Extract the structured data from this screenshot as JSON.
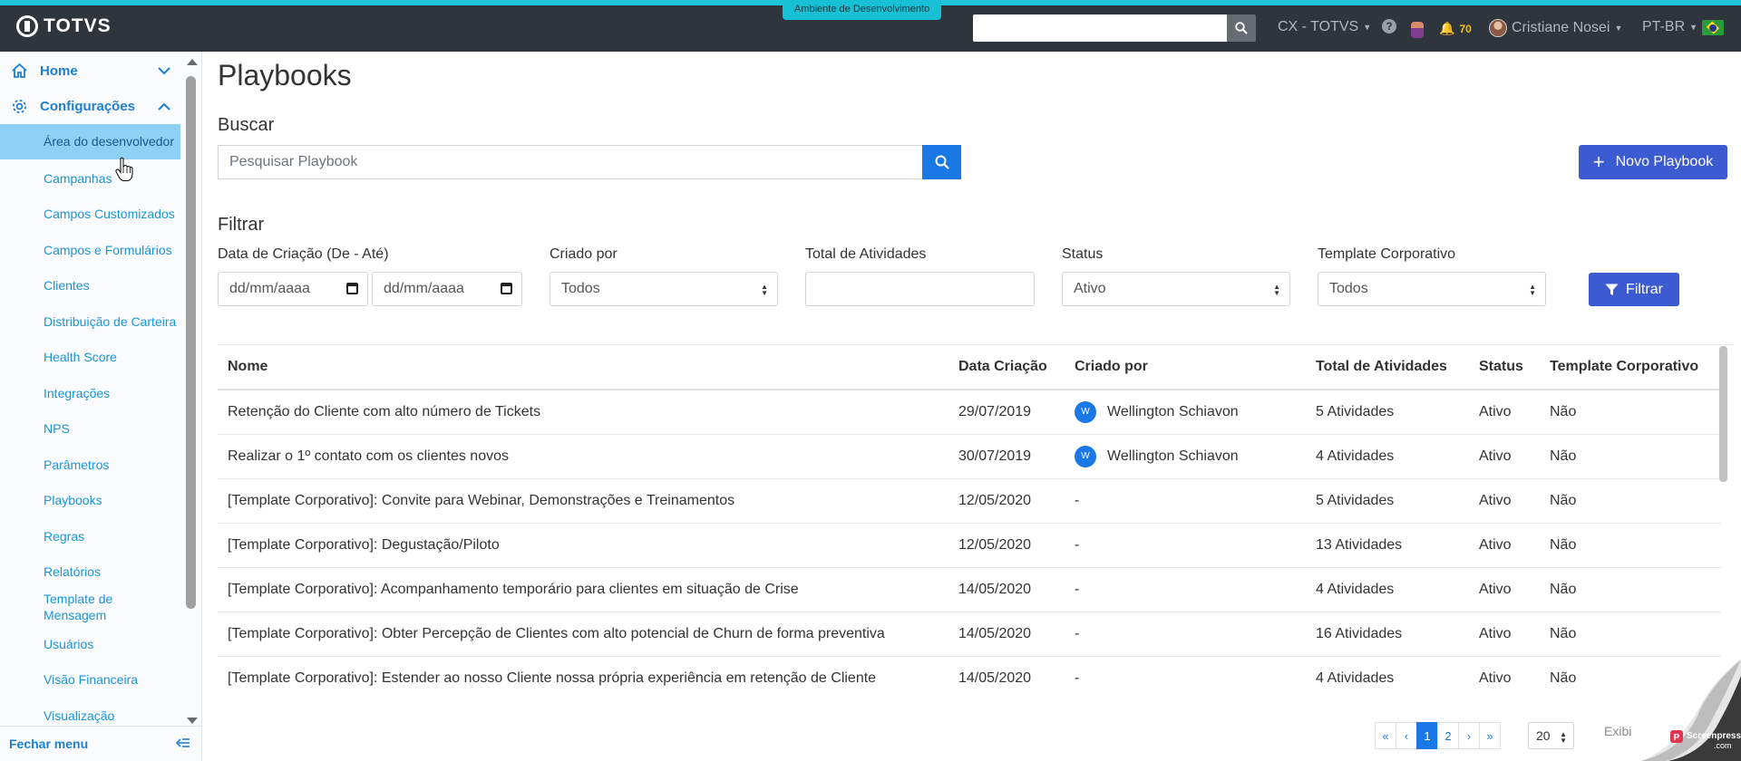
{
  "topbar": {
    "brand": "TOTVS",
    "env_badge": "Ambiente de Desenvolvimento",
    "company": "CX - TOTVS",
    "help": "?",
    "notifications_count": "70",
    "user_name": "Cristiane Nosei",
    "language": "PT-BR",
    "icons": [
      "search-icon",
      "help-icon",
      "bell-icon",
      "brazil-flag-icon"
    ]
  },
  "sidebar": {
    "groups": [
      {
        "label": "Home",
        "icon": "home-icon"
      },
      {
        "label": "Configurações",
        "icon": "gear-icon"
      }
    ],
    "items": [
      {
        "label": "Área do desenvolvedor"
      },
      {
        "label": "Campanhas"
      },
      {
        "label": "Campos Customizados"
      },
      {
        "label": "Campos e Formulários"
      },
      {
        "label": "Clientes"
      },
      {
        "label": "Distribuição de Carteira"
      },
      {
        "label": "Health Score"
      },
      {
        "label": "Integrações"
      },
      {
        "label": "NPS"
      },
      {
        "label": "Parâmetros"
      },
      {
        "label": "Playbooks"
      },
      {
        "label": "Regras"
      },
      {
        "label": "Relatórios"
      },
      {
        "label": "Template de Mensagem"
      },
      {
        "label": "Usuários"
      },
      {
        "label": "Visão Financeira"
      },
      {
        "label": "Visualização"
      }
    ],
    "footer_label": "Fechar menu"
  },
  "main": {
    "title": "Playbooks",
    "search_section": "Buscar",
    "search_placeholder": "Pesquisar Playbook",
    "new_button": "Novo Playbook",
    "filter_section": "Filtrar",
    "filters": {
      "date_label": "Data de Criação (De - Até)",
      "date_from_placeholder": "dd/mm/aaaa",
      "date_to_placeholder": "dd/mm/aaaa",
      "created_by_label": "Criado por",
      "created_by_value": "Todos",
      "total_activities_label": "Total de Atividades",
      "total_activities_value": "",
      "status_label": "Status",
      "status_value": "Ativo",
      "template_label": "Template Corporativo",
      "template_value": "Todos",
      "filter_button": "Filtrar"
    },
    "table": {
      "headers": [
        "Nome",
        "Data Criação",
        "Criado por",
        "Total de Atividades",
        "Status",
        "Template Corporativo"
      ],
      "rows": [
        {
          "name": "Retenção do Cliente com alto número de Tickets",
          "date": "29/07/2019",
          "avatar": "W",
          "creator": "Wellington Schiavon",
          "activities": "5 Atividades",
          "status": "Ativo",
          "template": "Não"
        },
        {
          "name": "Realizar o 1º contato com os clientes novos",
          "date": "30/07/2019",
          "avatar": "W",
          "creator": "Wellington Schiavon",
          "activities": "4 Atividades",
          "status": "Ativo",
          "template": "Não"
        },
        {
          "name": "[Template Corporativo]: Convite para Webinar, Demonstrações e Treinamentos",
          "date": "12/05/2020",
          "avatar": "",
          "creator": "-",
          "activities": "5 Atividades",
          "status": "Ativo",
          "template": "Não"
        },
        {
          "name": "[Template Corporativo]: Degustação/Piloto",
          "date": "12/05/2020",
          "avatar": "",
          "creator": "-",
          "activities": "13 Atividades",
          "status": "Ativo",
          "template": "Não"
        },
        {
          "name": "[Template Corporativo]: Acompanhamento temporário para clientes em situação de Crise",
          "date": "14/05/2020",
          "avatar": "",
          "creator": "-",
          "activities": "4 Atividades",
          "status": "Ativo",
          "template": "Não"
        },
        {
          "name": "[Template Corporativo]: Obter Percepção de Clientes com alto potencial de Churn de forma preventiva",
          "date": "14/05/2020",
          "avatar": "",
          "creator": "-",
          "activities": "16 Atividades",
          "status": "Ativo",
          "template": "Não"
        },
        {
          "name": "[Template Corporativo]: Estender ao nosso Cliente nossa própria experiência em retenção de Cliente",
          "date": "14/05/2020",
          "avatar": "",
          "creator": "-",
          "activities": "4 Atividades",
          "status": "Ativo",
          "template": "Não"
        }
      ]
    },
    "pagination": {
      "first": "«",
      "prev": "‹",
      "pages": [
        "1",
        "2"
      ],
      "current_page": "1",
      "next": "›",
      "last": "»",
      "page_size": "20",
      "showing": "Exibi"
    },
    "watermark": "Screenpresso .com"
  },
  "colors": {
    "accent": "#1a78e6",
    "primary_button": "#3d5bd0",
    "topbar": "#2f353d",
    "env_strip": "#20c4d8",
    "sidebar_active": "#8fd0f5",
    "link": "#1a95d6"
  }
}
